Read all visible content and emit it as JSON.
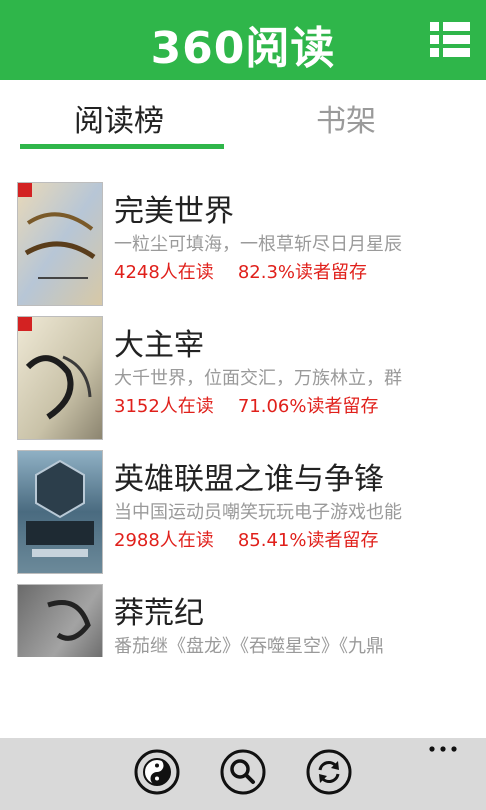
{
  "header": {
    "title": "360阅读",
    "menu_icon": "list-menu-icon"
  },
  "colors": {
    "brand_green": "#2fb64a",
    "stats_red": "#e0201b",
    "muted_gray": "#9a9a9a"
  },
  "tabs": [
    {
      "label": "阅读榜",
      "active": true
    },
    {
      "label": "书架",
      "active": false
    }
  ],
  "books": [
    {
      "title": "完美世界",
      "desc": "一粒尘可填海，一根草斩尽日月星辰",
      "readers": "4248人在读",
      "retention": "82.3%读者留存"
    },
    {
      "title": "大主宰",
      "desc": "大千世界，位面交汇，万族林立，群",
      "readers": "3152人在读",
      "retention": "71.06%读者留存"
    },
    {
      "title": "英雄联盟之谁与争锋",
      "desc": "当中国运动员嘲笑玩玩电子游戏也能",
      "readers": "2988人在读",
      "retention": "85.41%读者留存"
    },
    {
      "title": "莽荒纪",
      "desc": "番茄继《盘龙》《吞噬星空》《九鼎",
      "readers": "",
      "retention": ""
    }
  ],
  "bottom_bar": {
    "buttons": [
      "yin-yang-icon",
      "search-icon",
      "refresh-icon"
    ],
    "more_icon": "more-ellipsis-icon"
  }
}
